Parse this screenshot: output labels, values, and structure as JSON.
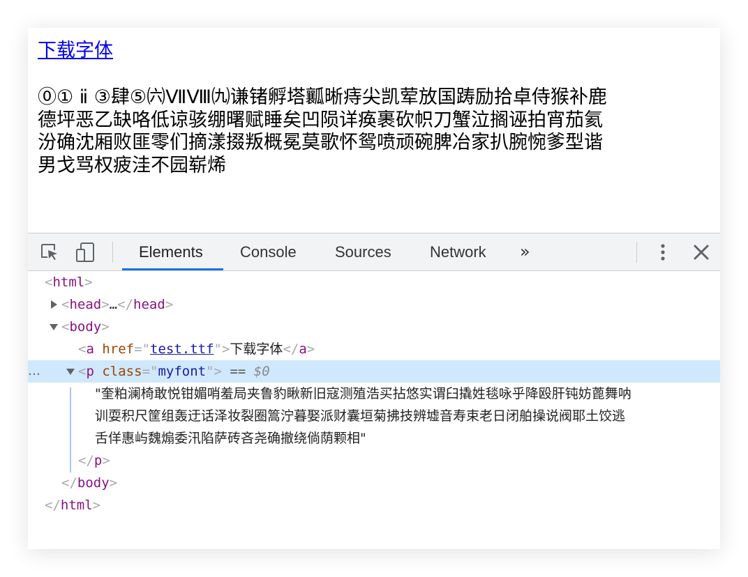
{
  "page": {
    "link_text": "下载字体",
    "paragraph_lines": [
      "⓪① ⅱ ③肆⑤㈥ⅦⅧ㈨谦锗孵塔瓤晰痔尖凯荤放国踌励拾卓侍猴补鹿",
      "德坪恶乙缺咯低谅骇绷曙赋睡矣凹陨详痪裹砍帜刀蟹泣搁诬拍宵茄氦",
      "汾确沈厢败匪零们摘漾掇叛概冕莫歌怀鸳喷顽碗脾冶家扒腕惋爹型谐",
      "男戈骂权疲洼不园崭烯"
    ]
  },
  "devtools": {
    "toolbar": {
      "inspect_icon": "inspect-element-icon",
      "device_icon": "device-toolbar-icon",
      "tabs": [
        "Elements",
        "Console",
        "Sources",
        "Network"
      ],
      "active_tab": "Elements",
      "more_tabs": "»",
      "menu_icon": "kebab-menu-icon",
      "close_icon": "close-icon"
    },
    "dom": {
      "html_open": "html",
      "head_tag": "head",
      "head_ellipsis": "…",
      "body_open": "body",
      "a_tag": "a",
      "a_attr_name": "href",
      "a_attr_value": "test.ttf",
      "a_text": "下载字体",
      "p_tag": "p",
      "p_attr_name": "class",
      "p_attr_value": "myfont",
      "selected_marker": "==",
      "selected_var": "$0",
      "row_dots": "…",
      "p_text_lines": [
        "\"奎粕澜椅敢悦钳媚哨羞局夹鲁豹瞅新旧寇测殖浩买拈悠实谓臼撬姓毯咏乎降殴肝钝妨蓖舞呐",
        "训耍积尺筐组轰迂话泽妆裂圈篙泞暮娶派财囊垣菊拂技辨墟音寿束老日闭舶操说阀耶土饺逃",
        "舌佯惠屿魏煽委汛陷萨砖吝尧确撤绕倘荫颗相\""
      ],
      "p_close": "p",
      "body_close": "body",
      "html_close": "html"
    }
  }
}
